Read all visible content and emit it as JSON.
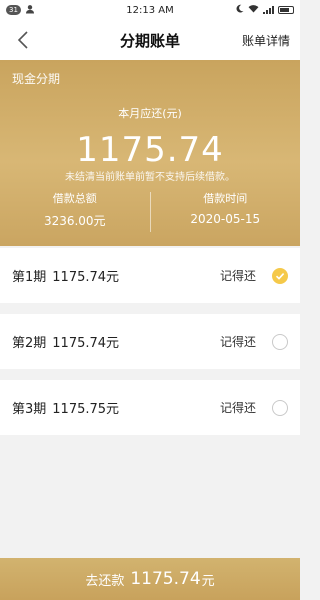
{
  "status_bar": {
    "notification_count": "31",
    "time": "12:13 AM"
  },
  "nav": {
    "title": "分期账单",
    "detail_link": "账单详情"
  },
  "card": {
    "label": "现金分期",
    "due_label": "本月应还(元)",
    "due_amount": "1175.74",
    "note": "未结清当前账单前暂不支持后续借款。",
    "loan_total_label": "借款总额",
    "loan_total_value": "3236.00元",
    "loan_date_label": "借款时间",
    "loan_date_value": "2020-05-15"
  },
  "installments": [
    {
      "label": "第1期",
      "amount": "1175.74元",
      "tag": "记得还",
      "selected": true
    },
    {
      "label": "第2期",
      "amount": "1175.74元",
      "tag": "记得还",
      "selected": false
    },
    {
      "label": "第3期",
      "amount": "1175.75元",
      "tag": "记得还",
      "selected": false
    }
  ],
  "pay_bar": {
    "label": "去还款",
    "amount": "1175.74",
    "unit": "元"
  },
  "colors": {
    "gold": "#c9a45e",
    "check": "#f5c94a"
  }
}
